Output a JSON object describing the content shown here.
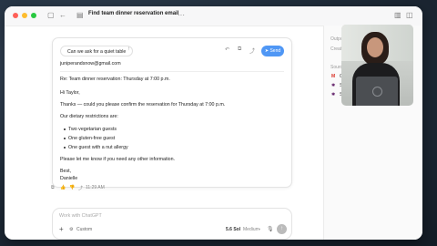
{
  "window": {
    "title": "Find team dinner reservation email"
  },
  "toolbar": {
    "ask_text": "Can we ask for a quiet table",
    "send_label": "Send"
  },
  "email": {
    "to": "juniperandsnow@gmail.com",
    "subject": "Re: Team dinner reservation: Thursday at 7:00 p.m.",
    "greeting": "Hi Taylor,",
    "line1": "Thanks — could you please confirm the reservation for Thursday at 7:00 p.m.",
    "line2": "Our dietary restrictions are:",
    "bullets": [
      "Two vegetarian guests",
      "One gluten-free guest",
      "One guest with a nut allergy"
    ],
    "line3": "Please let me know if you need any other information.",
    "signoff": "Best,",
    "signature": "Danielle"
  },
  "message_meta": {
    "time": "11:29 AM"
  },
  "right_panel": {
    "output_label": "Output",
    "create_label": "Create",
    "sources_label": "Sources",
    "source_items": [
      "Gr",
      "Sl",
      "Sl"
    ]
  },
  "composer": {
    "placeholder": "Work with ChatGPT",
    "custom_label": "Custom",
    "model": "5.6 Sol",
    "effort": "Medium"
  },
  "colors": {
    "accent": "#4f97f5",
    "close": "#fe5f57",
    "minimize": "#febc2e",
    "maximize": "#28c840"
  }
}
